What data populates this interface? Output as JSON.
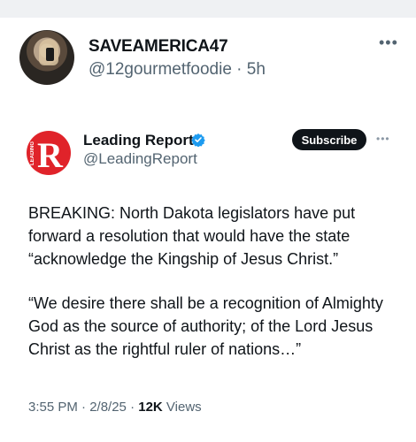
{
  "outer_post": {
    "name": "SAVEAMERICA47",
    "handle_line": "@12gourmetfoodie · 5h",
    "more_icon": "more-icon"
  },
  "inner_post": {
    "name": "Leading Report",
    "handle": "@LeadingReport",
    "logo_letter": "R",
    "logo_strip": "LEADING",
    "subscribe_label": "Subscribe",
    "paragraph1": "BREAKING: North Dakota legislators have put forward a resolution that would have the state “acknowledge the Kingship of Jesus Christ.”",
    "paragraph2": "“We desire there shall be a recognition of Almighty God as the source of authority; of the Lord Jesus Christ as the rightful ruler of nations…”",
    "time": "3:55 PM · 2/8/25 · ",
    "views_count": "12K",
    "views_label": " Views"
  },
  "colors": {
    "logo_red": "#e0232a",
    "verified_blue": "#1d9bf0",
    "secondary_text": "#536471"
  }
}
